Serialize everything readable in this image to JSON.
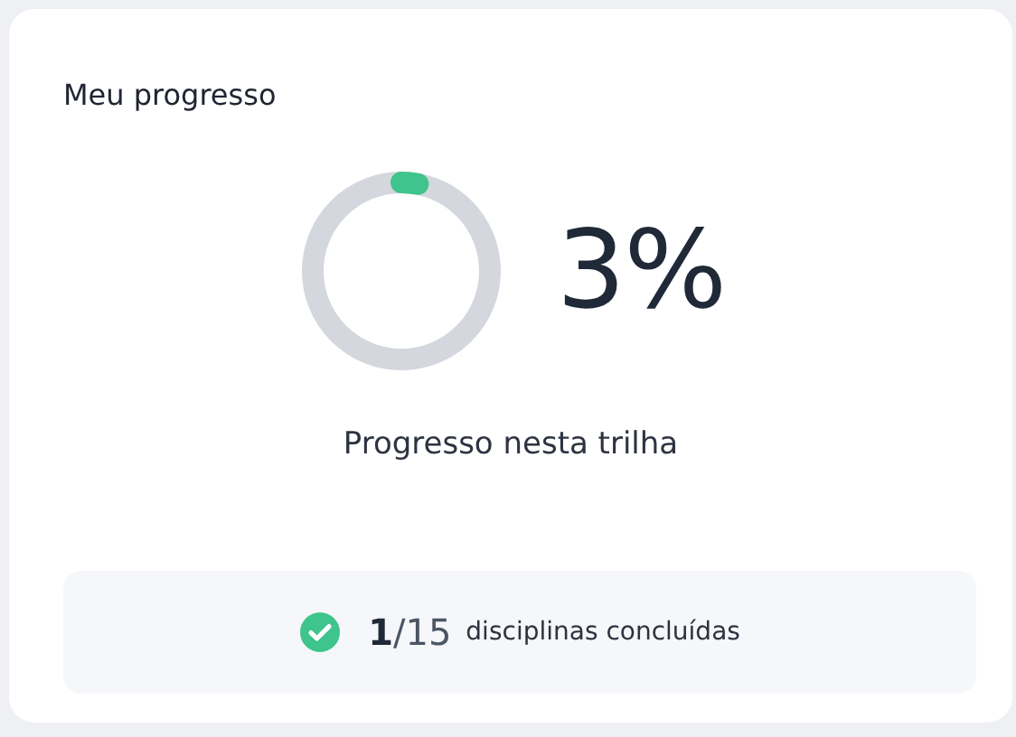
{
  "card": {
    "title": "Meu progresso"
  },
  "progress": {
    "level": 0.03,
    "percent": "3%",
    "caption": "Progresso nesta trilha"
  },
  "summary": {
    "completed": "1",
    "total": "/15",
    "label": "disciplinas concluídas"
  }
}
